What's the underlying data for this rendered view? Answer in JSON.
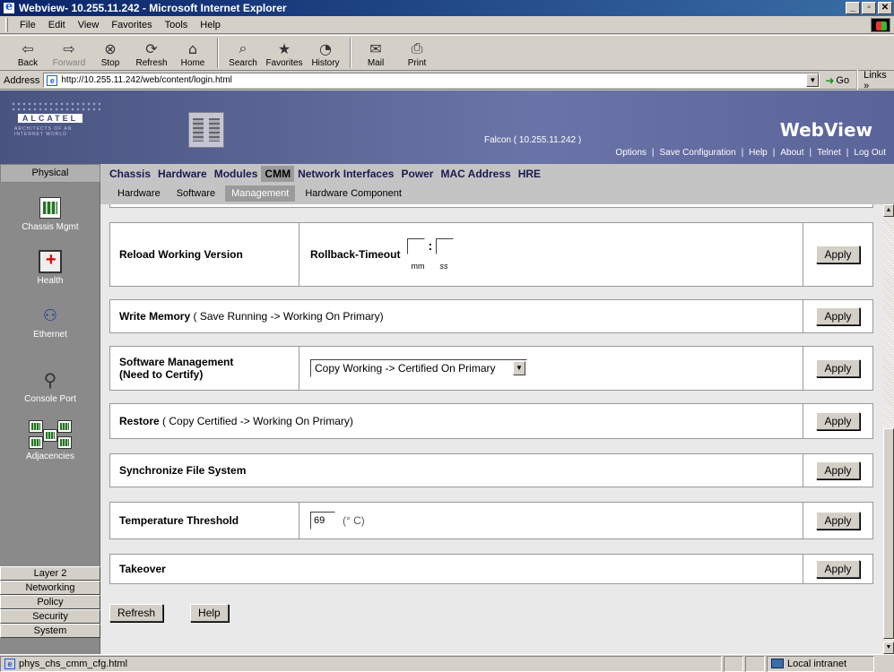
{
  "window": {
    "title": "Webview- 10.255.11.242 - Microsoft Internet Explorer",
    "controls": [
      "_",
      "▫",
      "✕"
    ]
  },
  "menu": [
    "File",
    "Edit",
    "View",
    "Favorites",
    "Tools",
    "Help"
  ],
  "toolbar": {
    "back": "Back",
    "forward": "Forward",
    "stop": "Stop",
    "refresh": "Refresh",
    "home": "Home",
    "search": "Search",
    "favorites": "Favorites",
    "history": "History",
    "mail": "Mail",
    "print": "Print"
  },
  "address": {
    "label": "Address",
    "url": "http://10.255.11.242/web/content/login.html",
    "go": "Go",
    "links": "Links »"
  },
  "banner": {
    "brand": "ALCATEL",
    "tagline": "ARCHITECTS OF AN INTERNET WORLD",
    "device": "Falcon ( 10.255.11.242 )",
    "product": "WebView",
    "links": [
      "Options",
      "|",
      "Save Configuration",
      "|",
      "Help",
      "|",
      "About",
      "|",
      "Telnet",
      "|",
      "Log Out"
    ]
  },
  "tabs": {
    "physical": "Physical",
    "main": [
      "Chassis",
      "Hardware",
      "Modules",
      "CMM",
      "Network Interfaces",
      "Power",
      "MAC Address",
      "HRE"
    ],
    "active": "CMM"
  },
  "subtabs": {
    "items": [
      "Hardware",
      "Software",
      "Management",
      "Hardware Component"
    ],
    "active": "Management"
  },
  "sidebar": {
    "items": [
      "Chassis Mgmt",
      "Health",
      "Ethernet",
      "Console Port",
      "Adjacencies"
    ],
    "menu": [
      "Layer 2",
      "Networking",
      "Policy",
      "Security",
      "System"
    ]
  },
  "rows": {
    "reload": {
      "label": "Reload Working Version",
      "rollback_label": "Rollback-Timeout",
      "sep": ":",
      "mm": "mm",
      "ss": "ss"
    },
    "write": {
      "label": "Write Memory",
      "note": "( Save Running -> Working On Primary)"
    },
    "software": {
      "label1": "Software Management",
      "label2": "(Need to Certify)",
      "selected": "Copy Working -> Certified On Primary"
    },
    "restore": {
      "label": "Restore",
      "note": "( Copy Certified -> Working On Primary)"
    },
    "sync": {
      "label": "Synchronize File System"
    },
    "temp": {
      "label": "Temperature Threshold",
      "value": "69",
      "unit": "(° C)"
    },
    "takeover": {
      "label": "Takeover"
    },
    "apply": "Apply"
  },
  "footer": {
    "refresh": "Refresh",
    "help": "Help"
  },
  "status": {
    "text": "phys_chs_cmm_cfg.html",
    "zone": "Local intranet"
  }
}
